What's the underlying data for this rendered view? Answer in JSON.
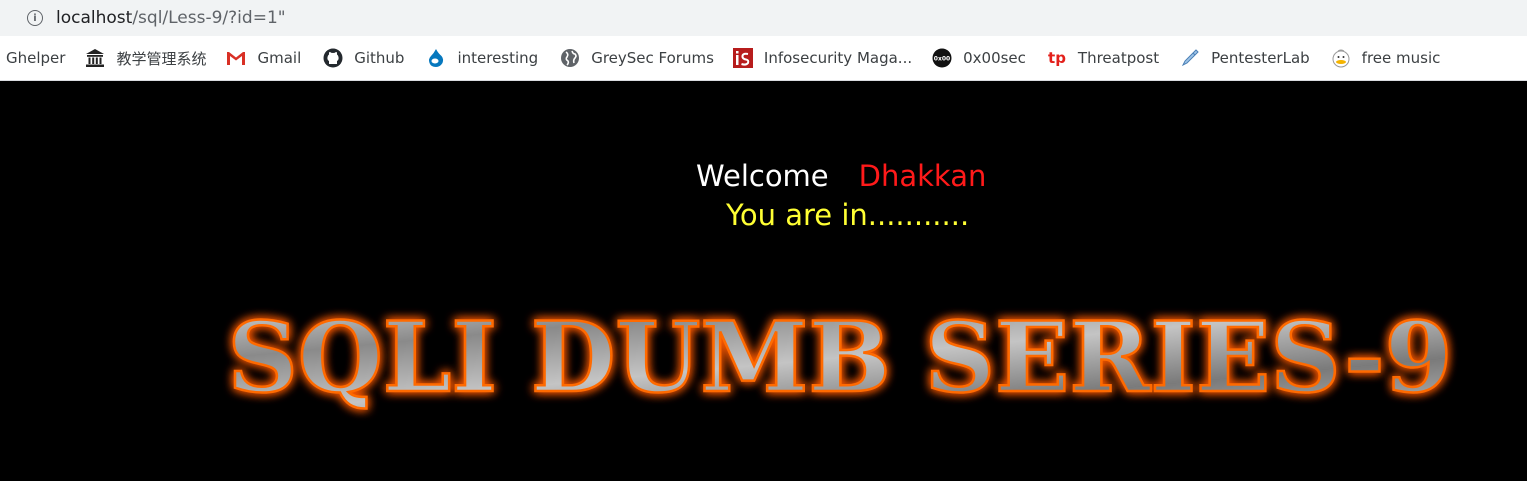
{
  "browser": {
    "url_host": "localhost",
    "url_path": "/sql/Less-9/?id=1\""
  },
  "bookmarks": [
    {
      "label": "Ghelper",
      "icon": "none"
    },
    {
      "label": "教学管理系统",
      "icon": "institution-icon"
    },
    {
      "label": "Gmail",
      "icon": "gmail-icon"
    },
    {
      "label": "Github",
      "icon": "github-icon"
    },
    {
      "label": "interesting",
      "icon": "drupal-icon"
    },
    {
      "label": "GreySec Forums",
      "icon": "globe-icon"
    },
    {
      "label": "Infosecurity Maga...",
      "icon": "infosecurity-icon"
    },
    {
      "label": "0x00sec",
      "icon": "0x00sec-icon"
    },
    {
      "label": "Threatpost",
      "icon": "threatpost-icon"
    },
    {
      "label": "PentesterLab",
      "icon": "pentesterlab-icon"
    },
    {
      "label": "free music",
      "icon": "music-duck-icon"
    }
  ],
  "page": {
    "welcome_text": "Welcome",
    "name_text": "Dhakkan",
    "status_text": "You are in...........",
    "banner_text": "SQLI DUMB SERIES-9"
  },
  "colors": {
    "background": "#000000",
    "welcome": "#ffffff",
    "name": "#ff1a1a",
    "status": "#ffff33",
    "banner_glow": "#ff5a00"
  }
}
